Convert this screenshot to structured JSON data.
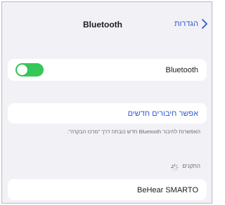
{
  "nav": {
    "title": "Bluetooth",
    "back_label": "הגדרות"
  },
  "bluetooth": {
    "label": "Bluetooth",
    "enabled": true,
    "toggle_color": "#35c759"
  },
  "allow_connections": {
    "label": "אפשר חיבורים חדשים",
    "footnote": "האפשרות לחיבור Bluetooth חדש כובתה דרך \"מרכז הבקרה\"."
  },
  "devices": {
    "header": "התקנים",
    "items": [
      {
        "label": "BeHear SMARTO"
      }
    ]
  },
  "colors": {
    "accent": "#2f57d6",
    "background": "#f2f1f6"
  },
  "icons": {
    "back": "chevron-right-icon",
    "spinner": "activity-spinner-icon"
  }
}
